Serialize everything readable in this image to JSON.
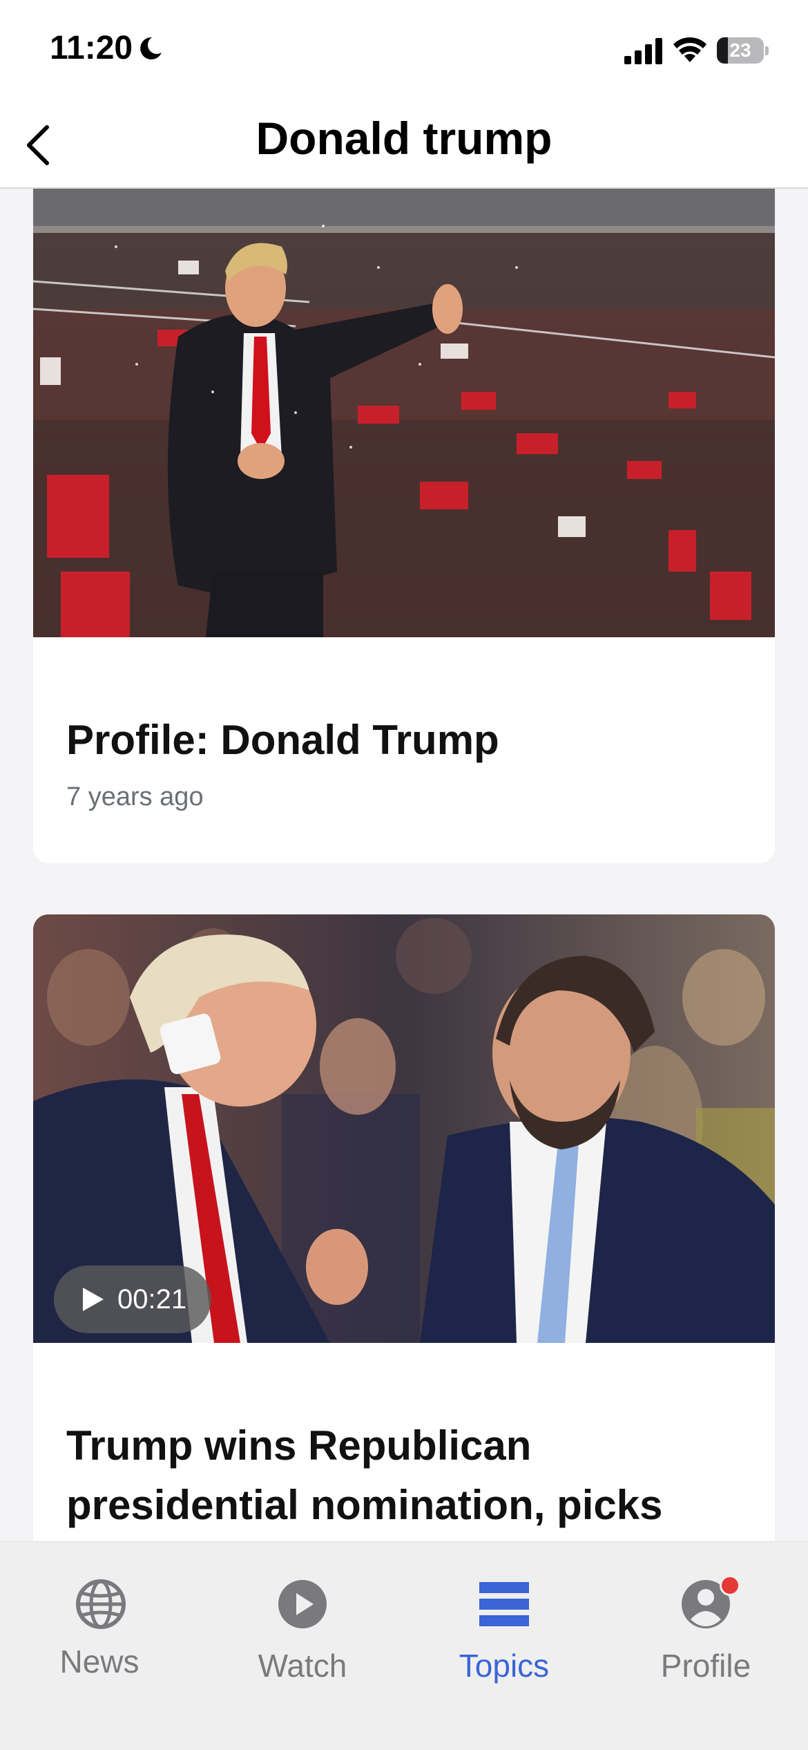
{
  "status_bar": {
    "time": "11:20",
    "battery_level": "23",
    "battery_fraction": 0.23
  },
  "header": {
    "title": "Donald trump"
  },
  "feed": {
    "cards": [
      {
        "title": "Profile: Donald Trump",
        "meta": "7 years ago",
        "image_icon": "photo"
      },
      {
        "title": "Trump wins Republican presidential nomination, picks",
        "video_duration": "00:21",
        "image_icon": "photo"
      }
    ]
  },
  "tab_bar": {
    "tabs": [
      {
        "label": "News",
        "icon": "globe-icon",
        "active": false
      },
      {
        "label": "Watch",
        "icon": "play-circle-icon",
        "active": false
      },
      {
        "label": "Topics",
        "icon": "topics-list-icon",
        "active": true
      },
      {
        "label": "Profile",
        "icon": "person-icon",
        "active": false,
        "has_notification": true
      }
    ]
  },
  "colors": {
    "accent": "#3b64d6",
    "inactive_tab": "#7a7a7e",
    "notification_dot": "#e53935",
    "meta_text": "#6b6f76"
  }
}
